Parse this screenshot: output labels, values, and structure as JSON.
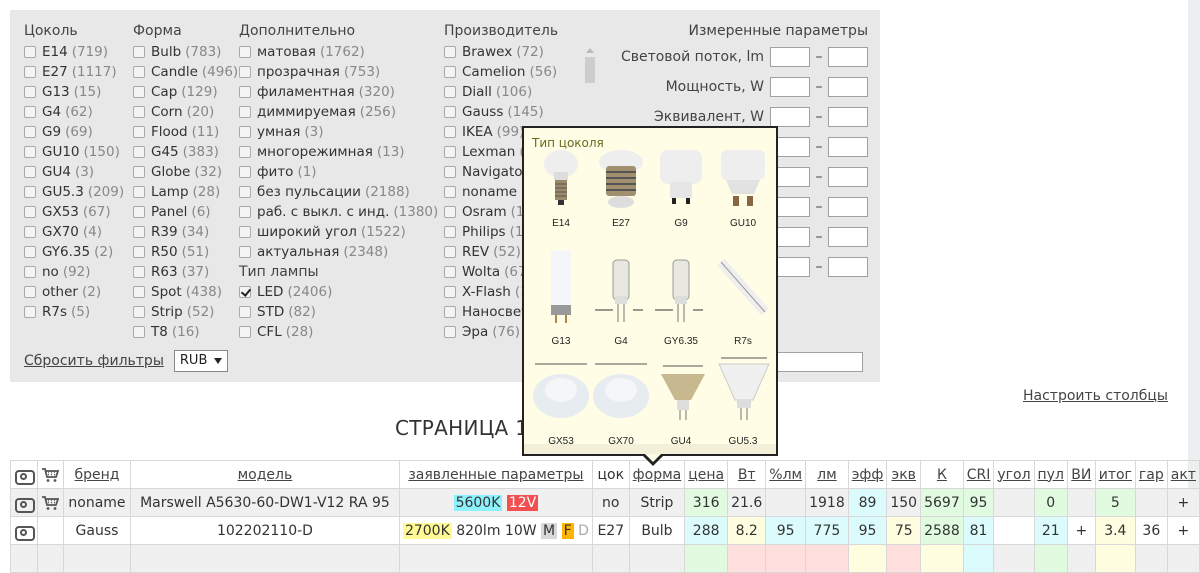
{
  "filters": {
    "base": {
      "title": "Цоколь",
      "options": [
        {
          "label": "E14",
          "count": "(719)",
          "checked": false
        },
        {
          "label": "E27",
          "count": "(1117)",
          "checked": false
        },
        {
          "label": "G13",
          "count": "(15)",
          "checked": false
        },
        {
          "label": "G4",
          "count": "(62)",
          "checked": false
        },
        {
          "label": "G9",
          "count": "(69)",
          "checked": false
        },
        {
          "label": "GU10",
          "count": "(150)",
          "checked": false
        },
        {
          "label": "GU4",
          "count": "(3)",
          "checked": false
        },
        {
          "label": "GU5.3",
          "count": "(209)",
          "checked": false
        },
        {
          "label": "GX53",
          "count": "(67)",
          "checked": false
        },
        {
          "label": "GX70",
          "count": "(4)",
          "checked": false
        },
        {
          "label": "GY6.35",
          "count": "(2)",
          "checked": false
        },
        {
          "label": "no",
          "count": "(92)",
          "checked": false
        },
        {
          "label": "other",
          "count": "(2)",
          "checked": false
        },
        {
          "label": "R7s",
          "count": "(5)",
          "checked": false
        }
      ]
    },
    "shape": {
      "title": "Форма",
      "options": [
        {
          "label": "Bulb",
          "count": "(783)",
          "checked": false
        },
        {
          "label": "Candle",
          "count": "(496)",
          "checked": false
        },
        {
          "label": "Cap",
          "count": "(129)",
          "checked": false
        },
        {
          "label": "Corn",
          "count": "(20)",
          "checked": false
        },
        {
          "label": "Flood",
          "count": "(11)",
          "checked": false
        },
        {
          "label": "G45",
          "count": "(383)",
          "checked": false
        },
        {
          "label": "Globe",
          "count": "(32)",
          "checked": false
        },
        {
          "label": "Lamp",
          "count": "(28)",
          "checked": false
        },
        {
          "label": "Panel",
          "count": "(6)",
          "checked": false
        },
        {
          "label": "R39",
          "count": "(34)",
          "checked": false
        },
        {
          "label": "R50",
          "count": "(51)",
          "checked": false
        },
        {
          "label": "R63",
          "count": "(37)",
          "checked": false
        },
        {
          "label": "Spot",
          "count": "(438)",
          "checked": false
        },
        {
          "label": "Strip",
          "count": "(52)",
          "checked": false
        },
        {
          "label": "T8",
          "count": "(16)",
          "checked": false
        }
      ]
    },
    "extra": {
      "title": "Дополнительно",
      "options": [
        {
          "label": "матовая",
          "count": "(1762)",
          "checked": false
        },
        {
          "label": "прозрачная",
          "count": "(753)",
          "checked": false
        },
        {
          "label": "филаментная",
          "count": "(320)",
          "checked": false
        },
        {
          "label": "диммируемая",
          "count": "(256)",
          "checked": false
        },
        {
          "label": "умная",
          "count": "(3)",
          "checked": false
        },
        {
          "label": "многорежимная",
          "count": "(13)",
          "checked": false
        },
        {
          "label": "фито",
          "count": "(1)",
          "checked": false
        },
        {
          "label": "без пульсации",
          "count": "(2188)",
          "checked": false
        },
        {
          "label": "раб. с выкл. с инд.",
          "count": "(1380)",
          "checked": false
        },
        {
          "label": "широкий угол",
          "count": "(1522)",
          "checked": false
        },
        {
          "label": "актуальная",
          "count": "(2348)",
          "checked": false
        }
      ],
      "lamp_type_title": "Тип лампы",
      "lamp_types": [
        {
          "label": "LED",
          "count": "(2406)",
          "checked": true
        },
        {
          "label": "STD",
          "count": "(82)",
          "checked": false
        },
        {
          "label": "CFL",
          "count": "(28)",
          "checked": false
        }
      ]
    },
    "maker": {
      "title": "Производитель",
      "options": [
        {
          "label": "Brawex",
          "count": "(72)",
          "checked": false
        },
        {
          "label": "Camelion",
          "count": "(56)",
          "checked": false
        },
        {
          "label": "Diall",
          "count": "(106)",
          "checked": false
        },
        {
          "label": "Gauss",
          "count": "(145)",
          "checked": false
        },
        {
          "label": "IKEA",
          "count": "(99)",
          "checked": false
        },
        {
          "label": "Lexman",
          "count": "(",
          "checked": false
        },
        {
          "label": "Navigator",
          "count": "",
          "checked": false
        },
        {
          "label": "noname",
          "count": "(",
          "checked": false
        },
        {
          "label": "Osram",
          "count": "(1",
          "checked": false
        },
        {
          "label": "Philips",
          "count": "(1",
          "checked": false
        },
        {
          "label": "REV",
          "count": "(52)",
          "checked": false
        },
        {
          "label": "Wolta",
          "count": "(67",
          "checked": false
        },
        {
          "label": "X-Flash",
          "count": "(1",
          "checked": false
        },
        {
          "label": "Наносвет",
          "count": "",
          "checked": false
        },
        {
          "label": "Эра",
          "count": "(76)",
          "checked": false
        }
      ]
    },
    "measured": {
      "title": "Измеренные параметры",
      "rows": [
        {
          "label": "Световой поток, lm",
          "min": "",
          "max": ""
        },
        {
          "label": "Мощность, W",
          "min": "",
          "max": ""
        },
        {
          "label": "Эквивалент, W",
          "min": "",
          "max": ""
        },
        {
          "label": "",
          "min": "",
          "max": ""
        },
        {
          "label": "",
          "min": "",
          "max": ""
        },
        {
          "label": "",
          "min": "",
          "max": ""
        },
        {
          "label": "",
          "min": "",
          "max": ""
        },
        {
          "label": "",
          "min": "",
          "max": ""
        }
      ],
      "search_value": ""
    },
    "reset_label": "Сбросить фильтры",
    "currency": "RUB",
    "dash": "–"
  },
  "configure_columns_label": "Настроить столбцы",
  "page_title": "СТРАНИЦА 1 ",
  "tooltip": {
    "title": "Тип цоколя",
    "bases": [
      "E14",
      "E27",
      "G9",
      "GU10",
      "G13",
      "G4",
      "GY6.35",
      "R7s",
      "GX53",
      "GX70",
      "GU4",
      "GU5.3"
    ]
  },
  "table": {
    "headers": [
      "бренд",
      "модель",
      "заявленные параметры",
      "цок",
      "форма",
      "цена",
      "Вт",
      "%лм",
      "лм",
      "эфф",
      "экв",
      "К",
      "CRI",
      "угол",
      "пул",
      "ВИ",
      "итог",
      "гар",
      "акт"
    ],
    "rows": [
      {
        "brand": "noname",
        "model": "Marswell A5630-60-DW1-V12 RA 95",
        "params": [
          {
            "text": "5600K",
            "style": "cyan"
          },
          {
            "text": "12V",
            "style": "red"
          }
        ],
        "base": "no",
        "shape": "Strip",
        "price": "316",
        "watt": "21.6",
        "pct_lm": "",
        "lm": "1918",
        "eff": "89",
        "equiv": "150",
        "kelvin": "5697",
        "cri": "95",
        "angle": "",
        "flicker": "0",
        "switch_ind": "",
        "total": "5",
        "warranty": "",
        "actual": "+",
        "has_cart": true
      },
      {
        "brand": "Gauss",
        "model": "102202110-D",
        "params": [
          {
            "text": "2700K",
            "style": "yellow"
          },
          {
            "text": "820lm",
            "style": ""
          },
          {
            "text": "10W",
            "style": ""
          },
          {
            "text": "M",
            "style": "gray"
          },
          {
            "text": "F",
            "style": "orange"
          },
          {
            "text": "D",
            "style": "dim"
          }
        ],
        "base": "E27",
        "shape": "Bulb",
        "price": "288",
        "watt": "8.2",
        "pct_lm": "95",
        "lm": "775",
        "eff": "95",
        "equiv": "75",
        "kelvin": "2588",
        "cri": "81",
        "angle": "",
        "flicker": "21",
        "switch_ind": "+",
        "total": "3.4",
        "warranty": "36",
        "actual": "+",
        "has_cart": false
      }
    ]
  }
}
